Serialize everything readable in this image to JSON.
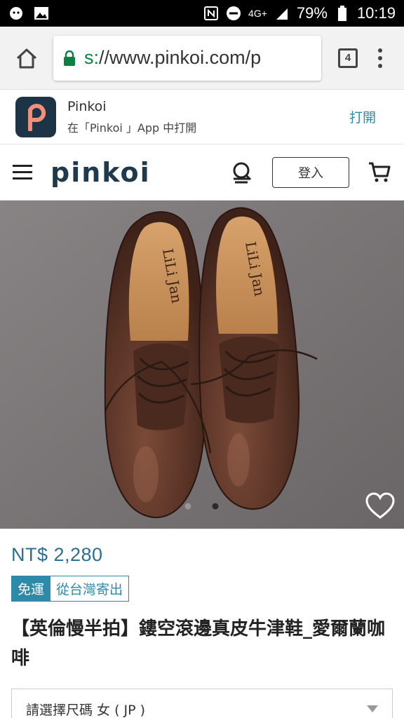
{
  "status_bar": {
    "network": "4G+",
    "battery": "79%",
    "time": "10:19"
  },
  "browser": {
    "url": "s://www.pinkoi.com/p",
    "url_scheme": "s:",
    "url_rest": "//www.pinkoi.com/p",
    "tab_count": "4"
  },
  "app_banner": {
    "name": "Pinkoi",
    "subtitle": "在「Pinkoi 」App 中打開",
    "open_label": "打開"
  },
  "site_header": {
    "logo": "pinkoi",
    "login_label": "登入"
  },
  "product": {
    "brand_on_insole": "LiLi Jan",
    "price": "NT$ 2,280",
    "tag_free_shipping": "免運",
    "tag_ships_from": "從台灣寄出",
    "title": "【英倫慢半拍】鏤空滾邊真皮牛津鞋_愛爾蘭咖啡",
    "size_placeholder": "請選擇尺碼 女 ( JP )",
    "image_dots": {
      "count": 2,
      "active_index": 1
    }
  },
  "colors": {
    "brand_dark": "#1f3a4d",
    "accent": "#2d8aa8",
    "price": "#2d6e94",
    "secure_green": "#0b8043"
  },
  "icons": [
    "home-icon",
    "lock-icon",
    "tabs-icon",
    "more-vert-icon",
    "menu-icon",
    "search-icon",
    "cart-icon",
    "heart-icon"
  ]
}
